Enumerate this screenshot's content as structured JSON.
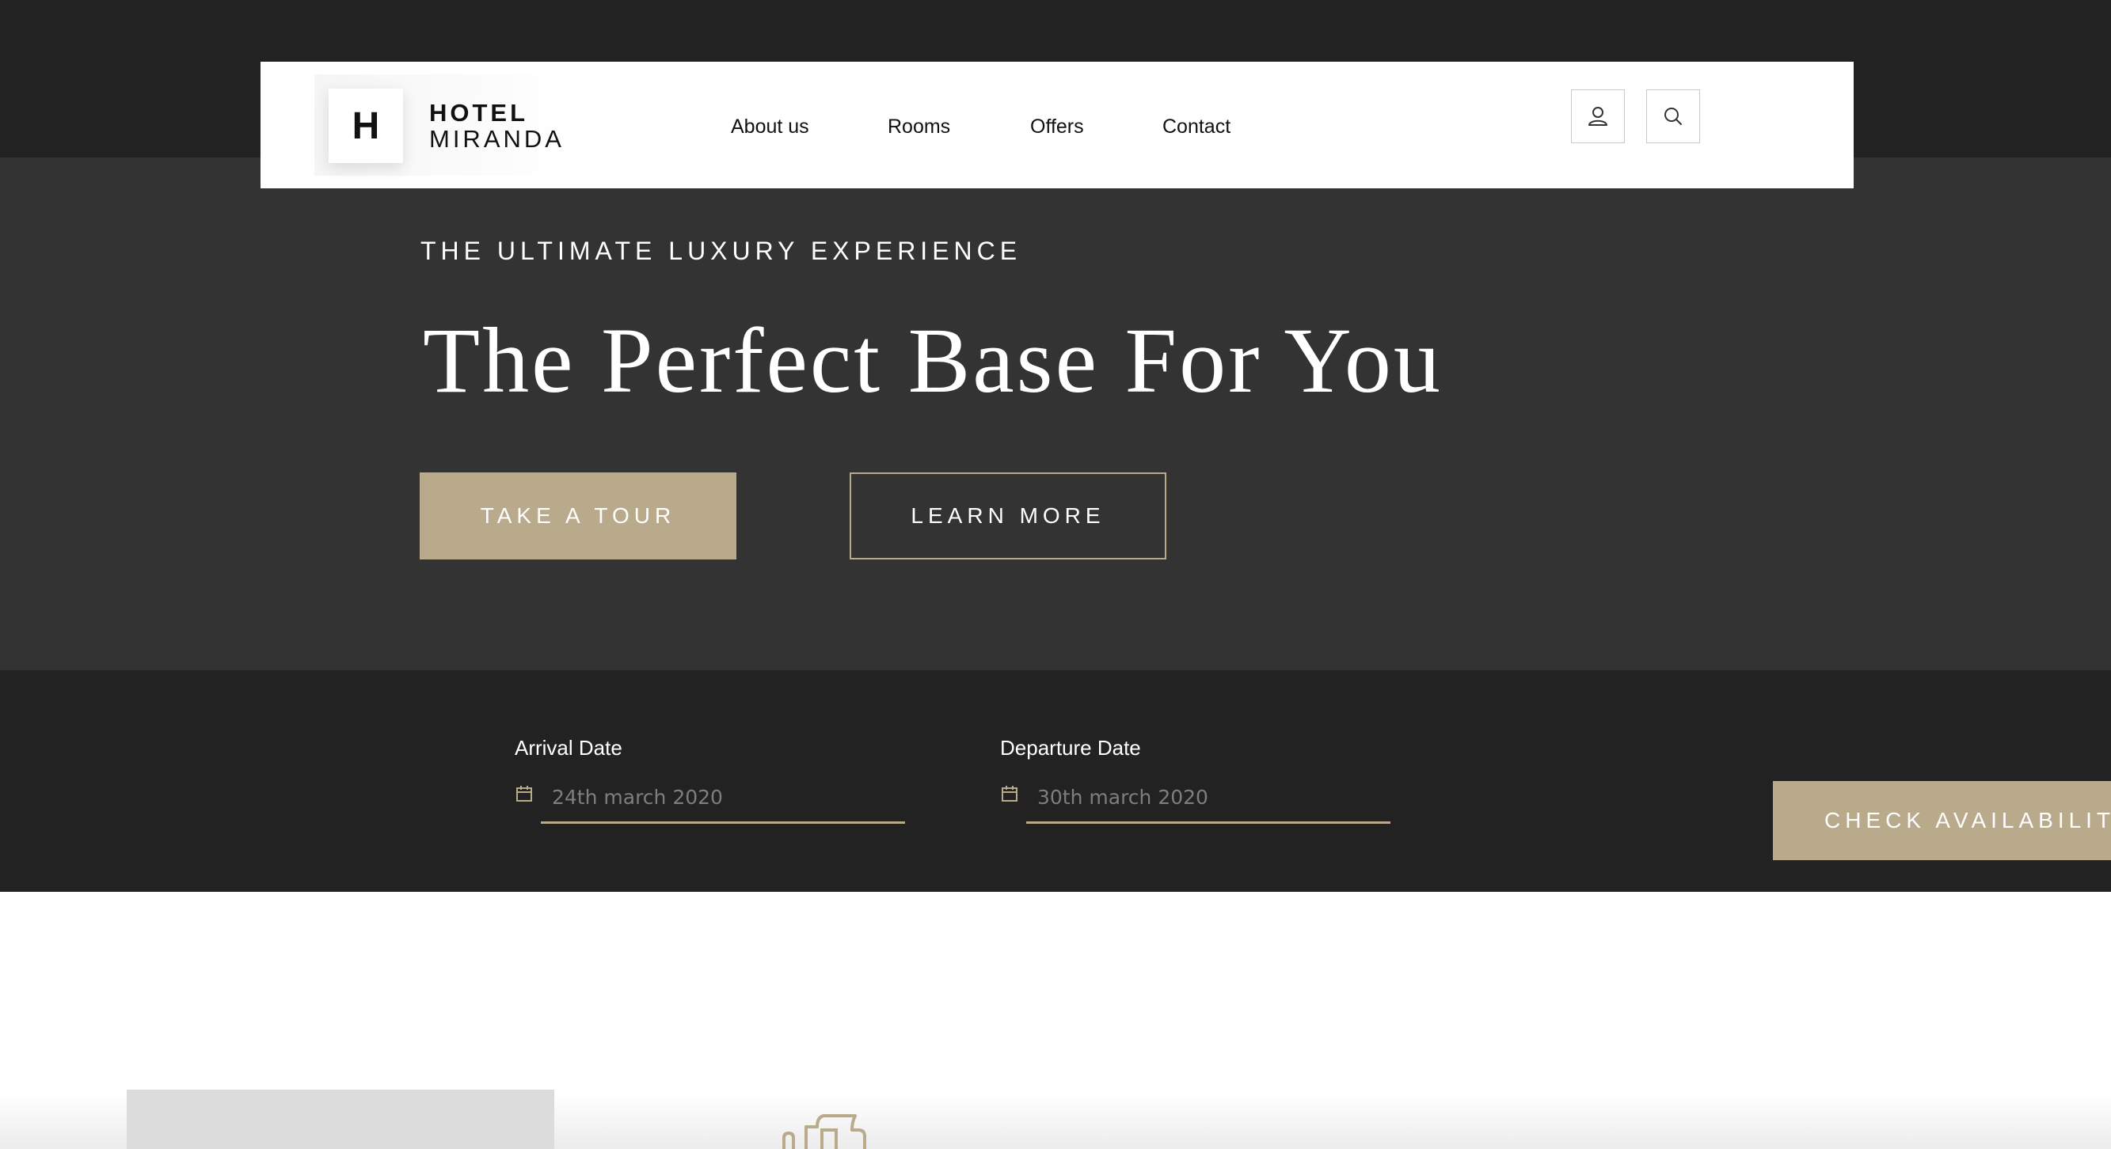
{
  "header": {
    "logo_letter": "H",
    "logo_line1": "HOTEL",
    "logo_line2": "MIRANDA",
    "nav": [
      {
        "label": "About us"
      },
      {
        "label": "Rooms"
      },
      {
        "label": "Offers"
      },
      {
        "label": "Contact"
      }
    ],
    "icons": [
      "user-icon",
      "search-icon"
    ]
  },
  "hero": {
    "eyebrow": "THE ULTIMATE LUXURY EXPERIENCE",
    "title": "The Perfect Base For You",
    "primary_button": "TAKE A TOUR",
    "secondary_button": "LEARN MORE"
  },
  "booking": {
    "arrival": {
      "label": "Arrival Date",
      "placeholder": "24th march 2020",
      "icon": "calendar-icon"
    },
    "departure": {
      "label": "Departure Date",
      "placeholder": "30th march 2020",
      "icon": "calendar-icon"
    },
    "submit": "CHECK AVAILABILITY"
  },
  "colors": {
    "accent": "#b9aa8c",
    "dark": "#222222",
    "hero_bg": "#333333",
    "header_bg": "#ffffff"
  }
}
